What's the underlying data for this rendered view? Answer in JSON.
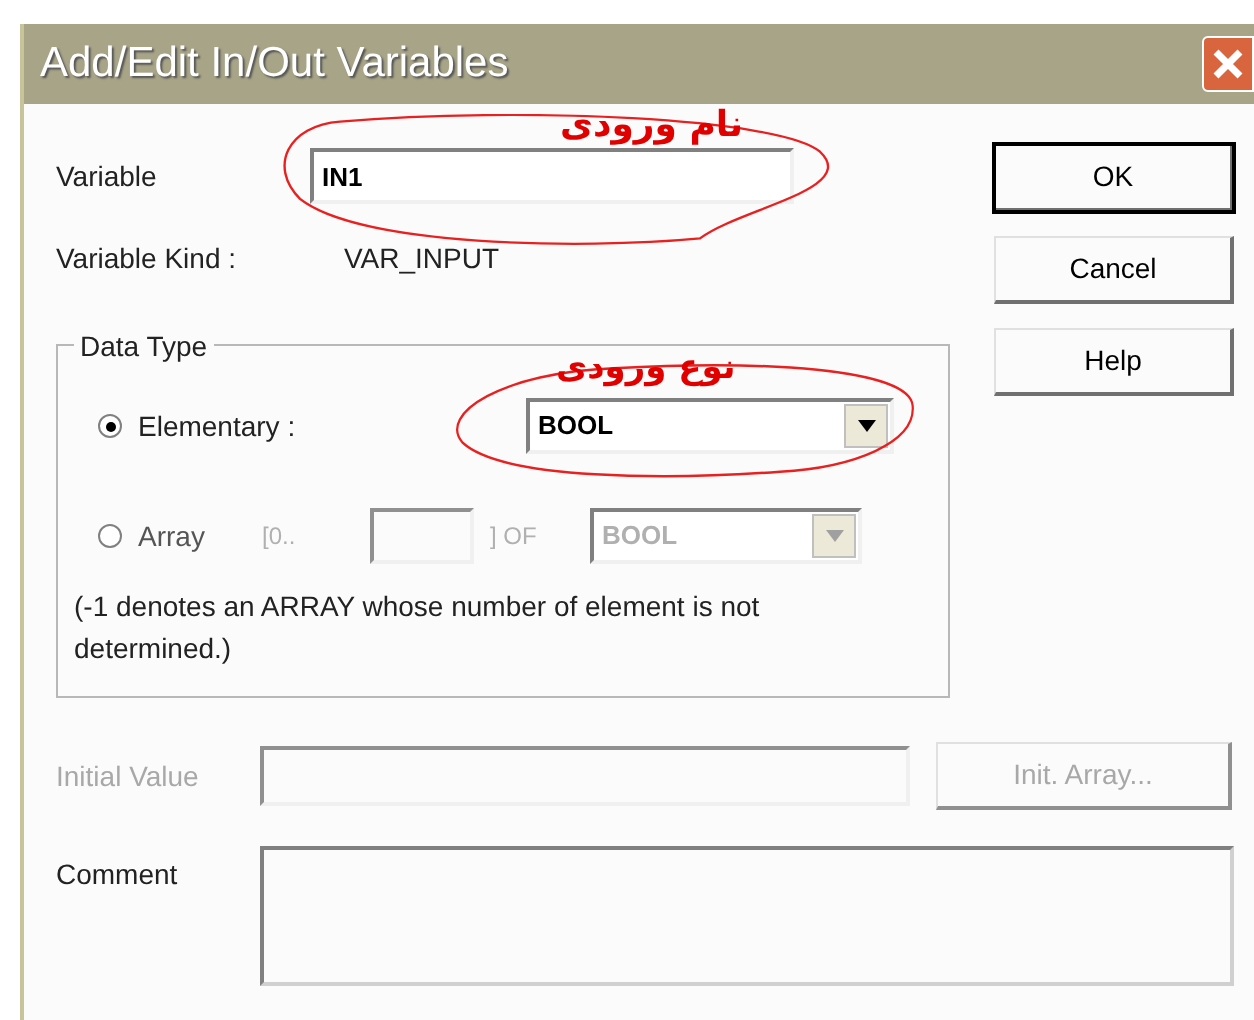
{
  "window": {
    "title": "Add/Edit In/Out Variables"
  },
  "variable": {
    "label": "Variable",
    "value": "IN1"
  },
  "variable_kind": {
    "label": "Variable Kind :",
    "value": "VAR_INPUT"
  },
  "data_type": {
    "title": "Data Type",
    "options": [
      {
        "kind": "elementary",
        "label": "Elementary :",
        "selected": true,
        "type_value": "BOOL"
      },
      {
        "kind": "array",
        "label": "Array",
        "selected": false,
        "range_prefix": "[0..",
        "range_suffix": "] OF",
        "type_value": "BOOL"
      }
    ],
    "note": "(-1 denotes an ARRAY whose number of element is not determined.)"
  },
  "initial_value": {
    "label": "Initial Value",
    "disabled": true,
    "button": "Init. Array..."
  },
  "comment": {
    "label": "Comment"
  },
  "buttons": [
    {
      "label": "OK",
      "default": true
    },
    {
      "label": "Cancel",
      "default": false
    },
    {
      "label": "Help",
      "default": false
    }
  ],
  "annotations": [
    {
      "text": "نام ورودی"
    },
    {
      "text": "نوع ورودی"
    }
  ]
}
